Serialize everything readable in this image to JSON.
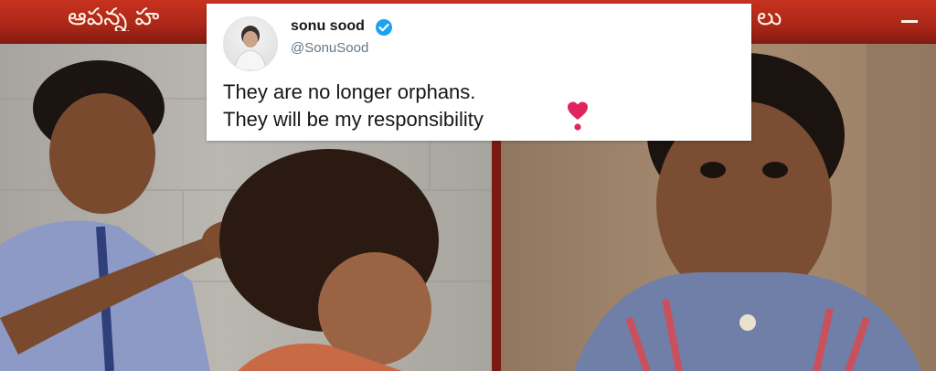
{
  "banner": {
    "text_left": "ఆపన్న హ",
    "text_right": "లు",
    "color": "#b52a1a"
  },
  "tweet": {
    "author_name": "sonu sood",
    "handle": "@SonuSood",
    "verified": true,
    "lines": [
      "They are no longer orphans.",
      "They will be my responsibility"
    ],
    "emoji": "heart-exclamation-icon",
    "verified_color": "#1da1f2",
    "heart_color": "#e0245e"
  },
  "photos": {
    "left": "boy-combing-girl-hair-photo",
    "right": "young-boy-portrait-photo"
  }
}
